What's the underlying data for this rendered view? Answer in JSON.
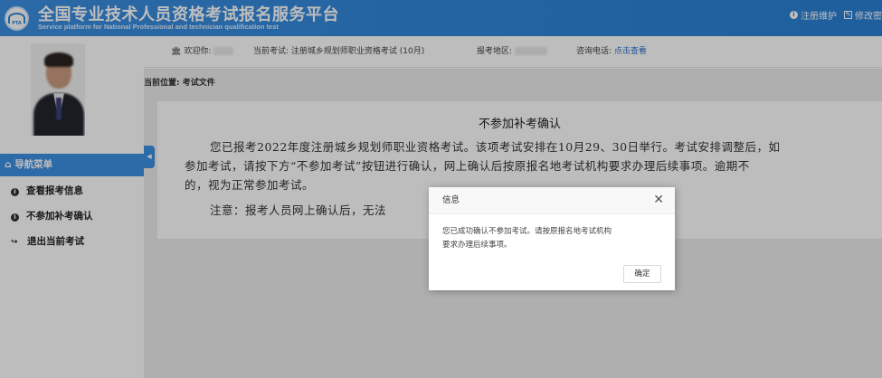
{
  "header": {
    "logo_text": "PTA",
    "title": "全国专业技术人员资格考试报名服务平台",
    "subtitle": "Service platform for National Professional and technician qualification test",
    "actions": [
      "注册维护",
      "修改密"
    ]
  },
  "sidebar": {
    "nav_title": "导航菜单",
    "items": [
      {
        "label": "查看报考信息"
      },
      {
        "label": "不参加补考确认"
      },
      {
        "label": "退出当前考试"
      }
    ]
  },
  "infobar": {
    "welcome": "欢迎你:",
    "exam_label": "当前考试: 注册城乡规划师职业资格考试 (10月)",
    "region_label": "报考地区:",
    "phone_label": "咨询电话:",
    "phone_link": "点击查看"
  },
  "content": {
    "breadcrumb": "当前位置: 考试文件",
    "doc_title": "不参加补考确认",
    "para1_line1": "您已报考2022年度注册城乡规划师职业资格考试。该项考试安排在10月29、30日举行。考试安排调整后，如",
    "para1_line2": "参加考试，请按下方“不参加考试”按钮进行确认，网上确认后按原报名地考试机构要求办理后续事项。逾期不",
    "para1_line3": "的，视为正常参加考试。",
    "para2": "注意：报考人员网上确认后，无法"
  },
  "dialog": {
    "title": "信息",
    "message_line1": "您已成功确认不参加考试。请按原报名地考试机构",
    "message_line2": "要求办理后续事项。",
    "ok_label": "确定"
  },
  "colors": {
    "header_bg": "#2f86da",
    "nav_accent": "#3c8fe3",
    "link": "#2a6fc9"
  }
}
